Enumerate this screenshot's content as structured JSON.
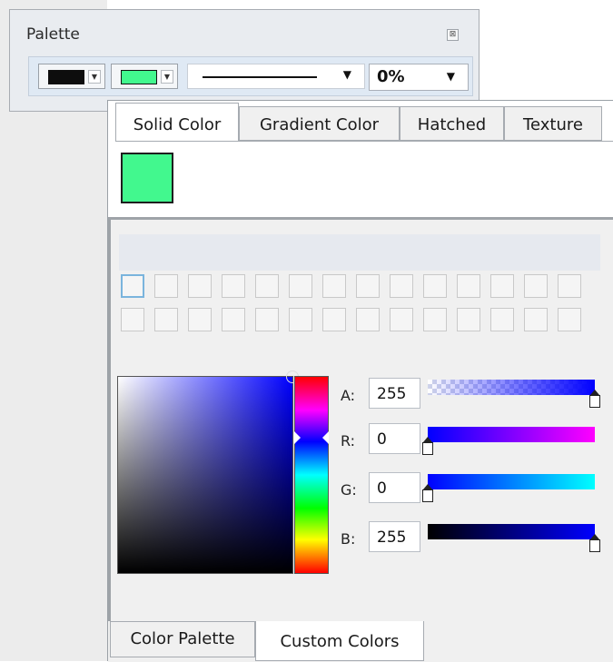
{
  "palette": {
    "title": "Palette",
    "close_icon": "close-icon",
    "stroke_color": "#0d0d0d",
    "fill_color": "#42f88e",
    "line_style": "solid",
    "opacity": "0%"
  },
  "tabs_top": [
    "Solid Color",
    "Gradient Color",
    "Hatched",
    "Texture"
  ],
  "active_tab_top": "Solid Color",
  "current_color": "#42f88e",
  "channels": {
    "a_label": "A:",
    "a_value": "255",
    "r_label": "R:",
    "r_value": "0",
    "g_label": "G:",
    "g_value": "0",
    "b_label": "B:",
    "b_value": "255"
  },
  "tabs_bottom": [
    "Color Palette",
    "Custom Colors"
  ],
  "active_tab_bottom": "Custom Colors"
}
